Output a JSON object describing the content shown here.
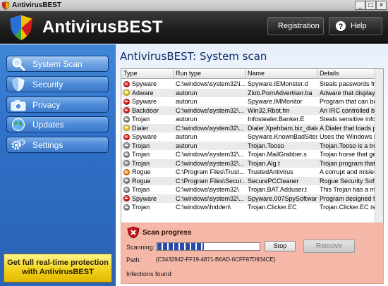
{
  "window": {
    "title": "AntivirusBEST",
    "controls": [
      "_",
      "□",
      "×"
    ]
  },
  "header": {
    "app_name": "AntivirusBEST",
    "registration_label": "Registration",
    "help_label": "Help"
  },
  "sidebar": {
    "items": [
      {
        "label": "System Scan",
        "icon": "magnifier-icon"
      },
      {
        "label": "Security",
        "icon": "shield-icon"
      },
      {
        "label": "Privacy",
        "icon": "camera-icon"
      },
      {
        "label": "Updates",
        "icon": "globe-icon"
      },
      {
        "label": "Settings",
        "icon": "gears-icon"
      }
    ],
    "promo": "Get full real-time protection with AntivirusBEST"
  },
  "main": {
    "title": "AntivirusBEST: System scan",
    "columns": [
      "Type",
      "Run type",
      "Name",
      "Details"
    ],
    "rows": [
      {
        "status": "red",
        "type": "Spyware",
        "run": "C:\\windows\\system32\\i...",
        "name": "Spyware.IEMonster.d",
        "details": "Steals passwords fro"
      },
      {
        "status": "yellow",
        "type": "Adware",
        "run": "autorun",
        "name": "Zlob.PornAdvertiser.ba",
        "details": "Adware that displays"
      },
      {
        "status": "red",
        "type": "Spyware",
        "run": "autorun",
        "name": "Spyware.IMMonitor",
        "details": "Program that can be"
      },
      {
        "status": "red",
        "type": "Backdoor",
        "run": "C:\\windows\\system32\\...",
        "name": "Win32.Rbot.fm",
        "details": "An IRC controlled ba"
      },
      {
        "status": "gray",
        "type": "Trojan",
        "run": "autorun",
        "name": "Infostealer.Banker.E",
        "details": "Steals sensitive infor"
      },
      {
        "status": "yellow",
        "type": "Dialer",
        "run": "C:\\windows\\system32\\...",
        "name": "Dialer.Xpehbam.biz_dialer",
        "details": "A Dialer that loads p"
      },
      {
        "status": "red",
        "type": "Spyware",
        "run": "autorun",
        "name": "Spyware.KnownBadSites",
        "details": "Uses the Windows h"
      },
      {
        "status": "gray",
        "type": "Trojan",
        "run": "autorun",
        "name": "Trojan.Tooso",
        "details": "Trojan.Tooso is a tro"
      },
      {
        "status": "gray",
        "type": "Trojan",
        "run": "C:\\windows\\system32\\...",
        "name": "Trojan.MailGrabber.s",
        "details": "Trojan horse that ge"
      },
      {
        "status": "gray",
        "type": "Trojan",
        "run": "C:\\windows\\system32\\...",
        "name": "Trojan.Alg.t",
        "details": "Trojan program that"
      },
      {
        "status": "orange",
        "type": "Rogue",
        "run": "C:\\Program Files\\Trust...",
        "name": "TrustedAntivirus",
        "details": "A corrupt and mislea"
      },
      {
        "status": "gray",
        "type": "Rogue",
        "run": "C:\\Program Files\\Secur...",
        "name": "SecurePCCleaner",
        "details": "Rogue Security Softw"
      },
      {
        "status": "gray",
        "type": "Trojan",
        "run": "C:\\windows\\system32\\",
        "name": "Trojan.BAT.Adduser.t",
        "details": "This Trojan has a ma"
      },
      {
        "status": "red",
        "type": "Spyware",
        "run": "C:\\windows\\system32\\...",
        "name": "Spyware.007SpySoftware",
        "details": "Program designed to"
      },
      {
        "status": "gray",
        "type": "Trojan",
        "run": "C:\\windows\\hidden\\",
        "name": "Trojan.Clicker.EC",
        "details": "Trojan.Clicker.EC is a"
      }
    ]
  },
  "scan": {
    "title": "Scan progress",
    "scanning_label": "Scanning:",
    "progress_percent": 45,
    "stop_label": "Stop",
    "remove_label": "Remove",
    "path_label": "Path:",
    "path_value": "{C3432842-FF19-4871-B6AD-6CFF87D934CE}",
    "infections_label": "Infections found:"
  }
}
